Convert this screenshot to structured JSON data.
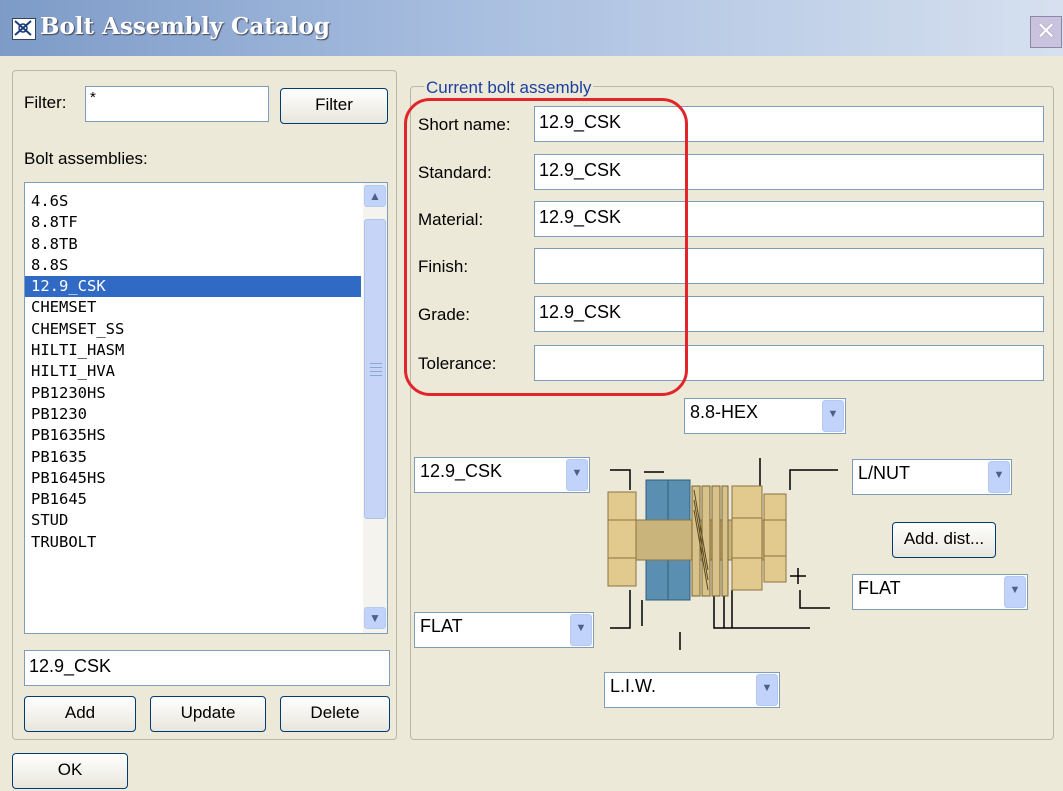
{
  "window": {
    "title": "Bolt Assembly Catalog"
  },
  "filter": {
    "label": "Filter:",
    "value": "*",
    "button": "Filter"
  },
  "list": {
    "label": "Bolt assemblies:",
    "items": [
      "4.6S",
      "8.8TF",
      "8.8TB",
      "8.8S",
      "12.9_CSK",
      "CHEMSET",
      "CHEMSET_SS",
      "HILTI_HASM",
      "HILTI_HVA",
      "PB1230HS",
      "PB1230",
      "PB1635HS",
      "PB1635",
      "PB1645HS",
      "PB1645",
      "STUD",
      "TRUBOLT"
    ],
    "selected_index": 4,
    "selected_value": "12.9_CSK"
  },
  "buttons": {
    "add": "Add",
    "update": "Update",
    "delete": "Delete",
    "ok": "OK",
    "add_dist": "Add. dist..."
  },
  "current": {
    "legend": "Current bolt assembly",
    "fields": [
      {
        "label": "Short name:",
        "value": "12.9_CSK"
      },
      {
        "label": "Standard:",
        "value": "12.9_CSK"
      },
      {
        "label": "Material:",
        "value": "12.9_CSK"
      },
      {
        "label": "Finish:",
        "value": ""
      },
      {
        "label": "Grade:",
        "value": "12.9_CSK"
      },
      {
        "label": "Tolerance:",
        "value": ""
      }
    ]
  },
  "combos": {
    "head": "8.8-HEX",
    "left_top": "12.9_CSK",
    "left_bottom": "FLAT",
    "bottom": "L.I.W.",
    "right_top": "L/NUT",
    "right_bottom": "FLAT"
  },
  "colors": {
    "selection": "#316ac5",
    "highlight_ring": "#e0262b",
    "legend": "#1c3fa0"
  },
  "icons": {
    "close": "close-icon",
    "app": "app-icon",
    "combo_arrow": "chevron-down-icon"
  }
}
